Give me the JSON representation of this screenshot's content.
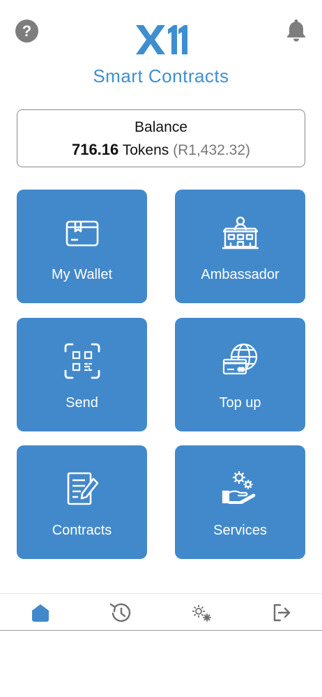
{
  "header": {
    "help_glyph": "?",
    "help_icon": "help-circle-icon",
    "bell_icon": "bell-icon",
    "logo_icon": "x11-logo",
    "title": "Smart Contracts"
  },
  "balance": {
    "label": "Balance",
    "amount": "716.16",
    "unit": "Tokens",
    "fiat": "(R1,432.32)"
  },
  "tiles": [
    {
      "label": "My Wallet",
      "icon": "wallet-icon"
    },
    {
      "label": "Ambassador",
      "icon": "building-icon"
    },
    {
      "label": "Send",
      "icon": "qr-scan-icon"
    },
    {
      "label": "Top up",
      "icon": "card-globe-icon"
    },
    {
      "label": "Contracts",
      "icon": "document-pen-icon"
    },
    {
      "label": "Services",
      "icon": "hand-gears-icon"
    }
  ],
  "nav": [
    {
      "icon": "home-icon",
      "active": true
    },
    {
      "icon": "history-icon",
      "active": false
    },
    {
      "icon": "settings-gears-icon",
      "active": false
    },
    {
      "icon": "logout-icon",
      "active": false
    }
  ],
  "colors": {
    "primary": "#4289cb",
    "title": "#3f8fd0",
    "icon_grey": "#7d7d7d",
    "active_nav": "#4289cb"
  }
}
